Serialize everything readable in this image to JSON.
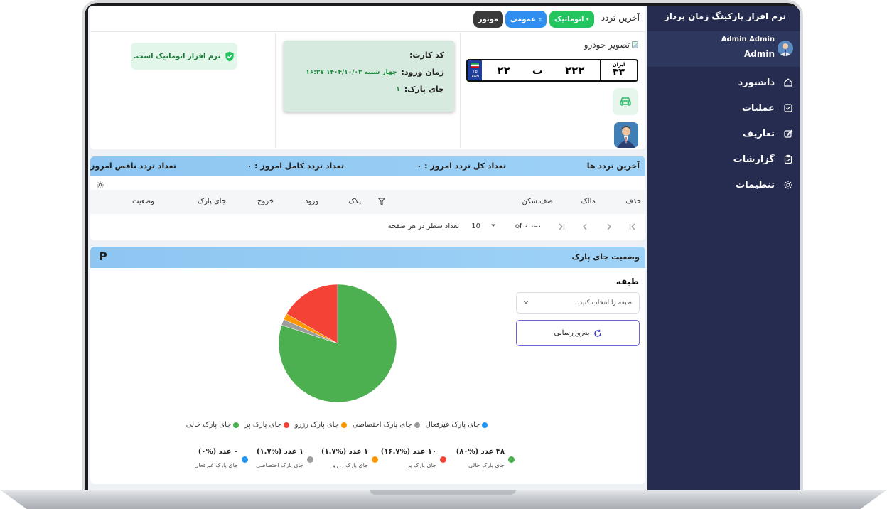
{
  "app": {
    "title": "نرم افزار پارکینگ زمان پرداز"
  },
  "profile": {
    "name": "Admin Admin",
    "role": "Admin"
  },
  "sidebar": {
    "items": [
      {
        "label": "داشبورد",
        "icon": "home-icon"
      },
      {
        "label": "عملیات",
        "icon": "check-square-icon"
      },
      {
        "label": "تعاریف",
        "icon": "edit-icon"
      },
      {
        "label": "گزارشات",
        "icon": "clipboard-icon"
      },
      {
        "label": "تنظیمات",
        "icon": "gear-icon"
      }
    ]
  },
  "entry": {
    "title": "آخرین تردد",
    "badges": {
      "auto": "اتوماتیک",
      "public": "عمومی",
      "motor": "موتور"
    },
    "car_image_alt": "تصویر خودرو",
    "plate": {
      "country": "ایران",
      "region": "۳۳",
      "first": "۲۲",
      "letter": "ت",
      "middle": "۲۲۲",
      "flag_text": "I.R.\nIRAN"
    },
    "card_label": "کد کارت:",
    "time_label": "زمان ورود:",
    "time_value": "چهار شنبه ۱۴۰۴/۱۰/۰۳ ۱۶:۳۷",
    "spot_label": "جای پارک:",
    "spot_value": "۱",
    "status_text": "نرم افزار اتوماتیک است."
  },
  "traffic": {
    "title": "آخرین تردد ها",
    "total_label": "تعداد کل تردد امروز : ۰",
    "complete_label": "تعداد تردد کامل امروز : ۰",
    "incomplete_label": "تعداد تردد ناقص امروز : ۰",
    "columns": [
      "حذف",
      "مالک",
      "صف شکن",
      "پلاک",
      "ورود",
      "خروج",
      "جای پارک",
      "وضعیت"
    ],
    "pager": {
      "rows_label": "تعداد سطر در هر صفحه",
      "rows_value": "10",
      "range": "۰–۰ of ۰"
    }
  },
  "park": {
    "title": "وضعیت جای پارک",
    "badge": "P",
    "floor_label": "طبقه",
    "floor_placeholder": "طبقه را انتخاب کنید.",
    "refresh_label": "به‌روزرسانی",
    "legend": [
      {
        "label": "جای پارک غیرفعال",
        "color": "#2196f3"
      },
      {
        "label": "جای پارک اختصاصی",
        "color": "#9e9e9e"
      },
      {
        "label": "جای پارک رزرو",
        "color": "#ff9800"
      },
      {
        "label": "جای پارک پر",
        "color": "#f44336"
      },
      {
        "label": "جای پارک خالی",
        "color": "#4caf50"
      }
    ],
    "stats": [
      {
        "count": "۴۸ عدد (%۸۰)",
        "label": "جای پارک خالی",
        "color": "#4caf50"
      },
      {
        "count": "۱۰ عدد (%۱۶.۷)",
        "label": "جای پارک پر",
        "color": "#f44336"
      },
      {
        "count": "۱ عدد (%۱.۷)",
        "label": "جای پارک رزرو",
        "color": "#ff9800"
      },
      {
        "count": "۱ عدد (%۱.۷)",
        "label": "جای پارک اختصاصی",
        "color": "#9e9e9e"
      },
      {
        "count": "۰ عدد (%۰)",
        "label": "جای پارک غیرفعال",
        "color": "#2196f3"
      }
    ]
  },
  "chart_data": {
    "type": "pie",
    "categories": [
      "جای پارک خالی",
      "جای پارک پر",
      "جای پارک رزرو",
      "جای پارک اختصاصی",
      "جای پارک غیرفعال"
    ],
    "values": [
      48,
      10,
      1,
      1,
      0
    ],
    "colors": [
      "#4caf50",
      "#f44336",
      "#ff9800",
      "#9e9e9e",
      "#2196f3"
    ],
    "legend": "bottom"
  }
}
